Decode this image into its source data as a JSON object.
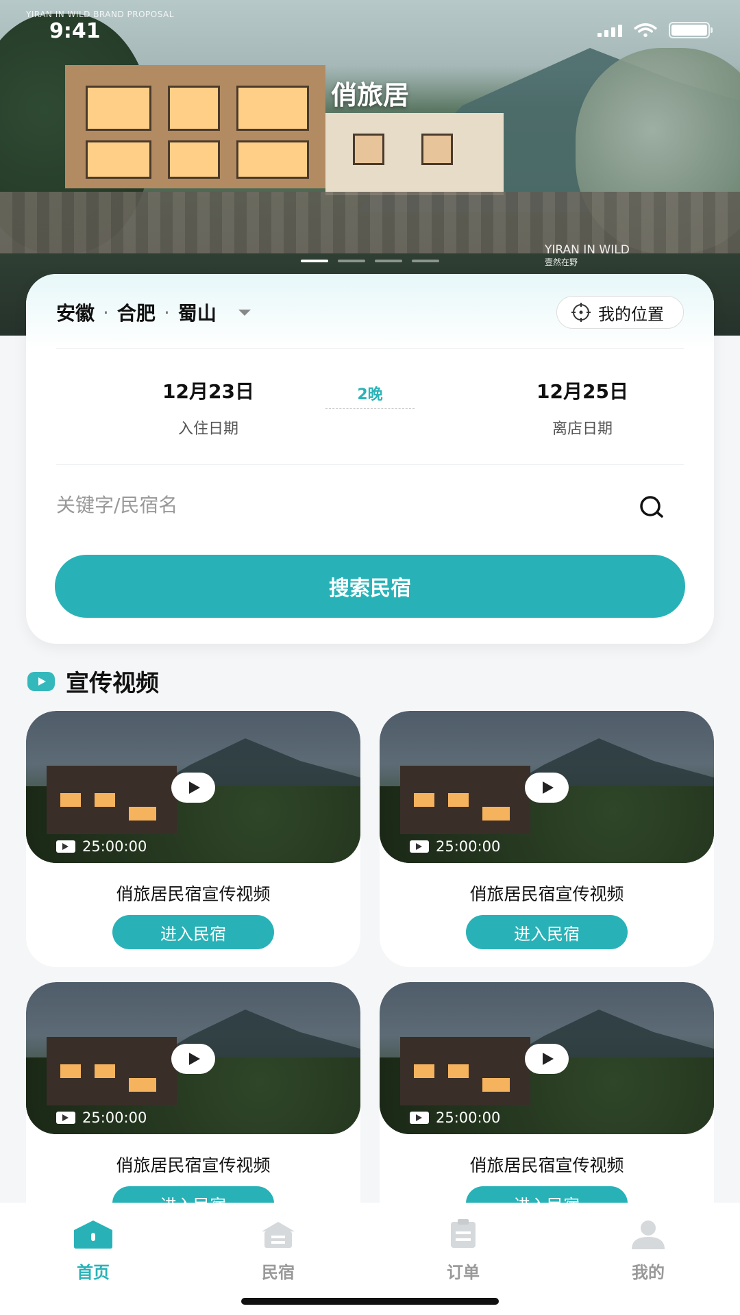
{
  "status_bar": {
    "time": "9:41"
  },
  "hero": {
    "title": "俏旅居",
    "brand_top": "YIRAN IN WILD BRAND PROPOSAL",
    "brand_bottom_en": "YIRAN IN WILD",
    "brand_bottom_cn": "壹然在野",
    "carousel_active_index": 0,
    "carousel_count": 4
  },
  "search": {
    "location": {
      "province": "安徽",
      "city": "合肥",
      "district": "蜀山"
    },
    "my_location_label": "我的位置",
    "checkin": {
      "date": "12月23日",
      "label": "入住日期"
    },
    "nights": "2晚",
    "checkout": {
      "date": "12月25日",
      "label": "离店日期"
    },
    "keyword_placeholder": "关键字/民宿名",
    "submit_label": "搜索民宿"
  },
  "videos": {
    "section_title": "宣传视频",
    "items": [
      {
        "duration": "25:00:00",
        "title": "俏旅居民宿宣传视频",
        "button": "进入民宿"
      },
      {
        "duration": "25:00:00",
        "title": "俏旅居民宿宣传视频",
        "button": "进入民宿"
      },
      {
        "duration": "25:00:00",
        "title": "俏旅居民宿宣传视频",
        "button": "进入民宿"
      },
      {
        "duration": "25:00:00",
        "title": "俏旅居民宿宣传视频",
        "button": "进入民宿"
      }
    ]
  },
  "tabbar": {
    "items": [
      {
        "label": "首页",
        "icon": "home-icon",
        "active": true
      },
      {
        "label": "民宿",
        "icon": "house-icon",
        "active": false
      },
      {
        "label": "订单",
        "icon": "order-icon",
        "active": false
      },
      {
        "label": "我的",
        "icon": "profile-icon",
        "active": false
      }
    ]
  },
  "colors": {
    "accent": "#28b2b7",
    "inactive": "#999999"
  }
}
